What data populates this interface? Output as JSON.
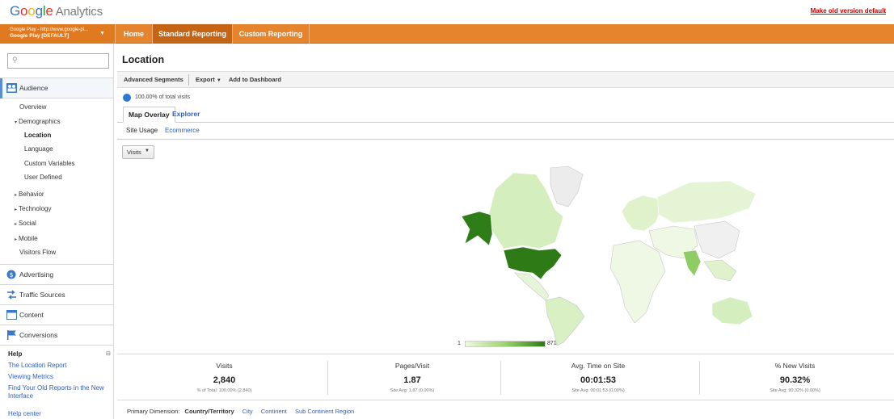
{
  "app": {
    "logo_google": "Google",
    "logo_analytics": "Analytics",
    "make_old_default": "Make old version default"
  },
  "nav": {
    "account_line1": "Google Play - http://www.google-pl...",
    "account_line2": "Google Play [DEFAULT]",
    "tabs": [
      {
        "label": "Home"
      },
      {
        "label": "Standard Reporting"
      },
      {
        "label": "Custom Reporting"
      }
    ]
  },
  "sidebar": {
    "search_placeholder": "",
    "sections": {
      "audience": "Audience",
      "advertising": "Advertising",
      "traffic_sources": "Traffic Sources",
      "content": "Content",
      "conversions": "Conversions"
    },
    "audience_items": {
      "overview": "Overview",
      "demographics": "Demographics",
      "location": "Location",
      "language": "Language",
      "custom_variables": "Custom Variables",
      "user_defined": "User Defined",
      "behavior": "Behavior",
      "technology": "Technology",
      "social": "Social",
      "mobile": "Mobile",
      "visitors_flow": "Visitors Flow"
    },
    "help": {
      "title": "Help",
      "links": [
        "The Location Report",
        "Viewing Metrics",
        "Find Your Old Reports in the New Interface",
        "Help center"
      ]
    }
  },
  "main": {
    "title": "Location",
    "toolbar": {
      "advanced_segments": "Advanced Segments",
      "export": "Export",
      "add_to_dashboard": "Add to Dashboard"
    },
    "total_visits_pct": "100.00% of total visits",
    "tabs": {
      "map_overlay": "Map Overlay",
      "explorer": "Explorer"
    },
    "subtabs": {
      "site_usage": "Site Usage",
      "ecommerce": "Ecommerce"
    },
    "metric_selector": "Visits",
    "legend": {
      "min": "1",
      "max": "871"
    },
    "colors": {
      "accent": "#e5842c",
      "link": "#2d5fbf",
      "map_dark": "#2d7a16",
      "map_light": "#d9efc4"
    },
    "stats": [
      {
        "label": "Visits",
        "value": "2,840",
        "sub": "% of Total: 100.00% (2,840)"
      },
      {
        "label": "Pages/Visit",
        "value": "1.87",
        "sub": "Site Avg: 1.87 (0.00%)"
      },
      {
        "label": "Avg. Time on Site",
        "value": "00:01:53",
        "sub": "Site Avg: 00:01:53 (0.00%)"
      },
      {
        "label": "% New Visits",
        "value": "90.32%",
        "sub": "Site Avg: 90.32% (0.00%)"
      }
    ],
    "primary_dimension": {
      "label": "Primary Dimension:",
      "selected": "Country/Territory",
      "options": [
        "City",
        "Continent",
        "Sub Continent Region"
      ]
    }
  }
}
